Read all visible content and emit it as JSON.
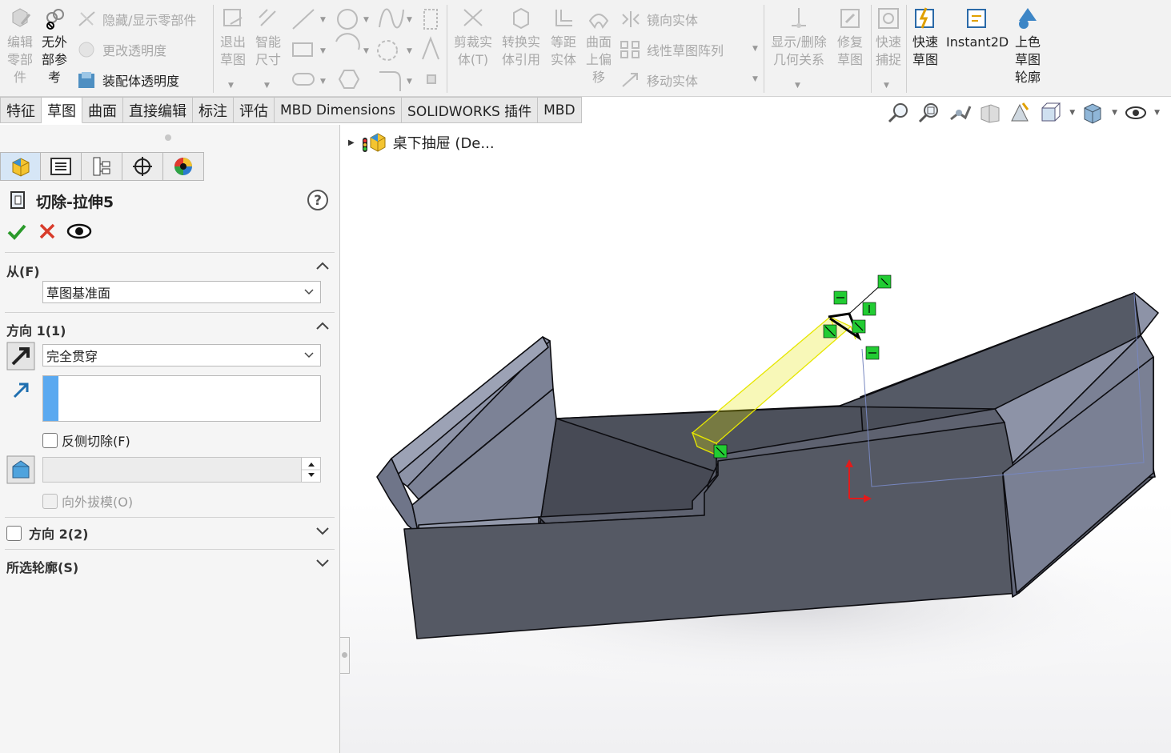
{
  "ribbon": {
    "edit_component": "编辑\n零部\n件",
    "no_external_refs": "无外\n部参\n考",
    "hide_show_components": "隐藏/显示零部件",
    "change_transparency": "更改透明度",
    "assembly_transparency": "装配体透明度",
    "exit_sketch": "退出\n草图",
    "smart_dimension": "智能\n尺寸",
    "trim_entities": "剪裁实\n体(T)",
    "convert_entities": "转换实\n体引用",
    "offset_entities": "等距\n实体",
    "offset_on_surface": "曲面\n上偏\n移",
    "mirror_entities": "镜向实体",
    "linear_pattern": "线性草图阵列",
    "move_entities": "移动实体",
    "display_delete_relations": "显示/删除\n几何关系",
    "repair_sketch": "修复\n草图",
    "quick_snaps": "快速\n捕捉",
    "rapid_sketch": "快速\n草图",
    "instant2d": "Instant2D",
    "shaded_contours": "上色\n草图\n轮廓"
  },
  "tabs": [
    {
      "label": "特征"
    },
    {
      "label": "草图"
    },
    {
      "label": "曲面"
    },
    {
      "label": "直接编辑"
    },
    {
      "label": "标注"
    },
    {
      "label": "评估"
    },
    {
      "label": "MBD Dimensions"
    },
    {
      "label": "SOLIDWORKS 插件"
    },
    {
      "label": "MBD"
    }
  ],
  "active_tab": "草图",
  "pm": {
    "title": "切除-拉伸5",
    "from_header": "从(F)",
    "from_value": "草图基准面",
    "dir1_header": "方向 1(1)",
    "dir1_type": "完全贯穿",
    "flip_side": "反侧切除(F)",
    "draft_outward": "向外拔模(O)",
    "dir2_header": "方向 2(2)",
    "selected_contours": "所选轮廓(S)"
  },
  "tree": {
    "root_label": "桌下抽屉 (De..."
  },
  "colors": {
    "ok_green": "#2a9a2a",
    "cancel_red": "#d83b2a",
    "body_face": "#555964",
    "handle_green": "#22cc33",
    "sketch_yellow": "#e6e600"
  }
}
